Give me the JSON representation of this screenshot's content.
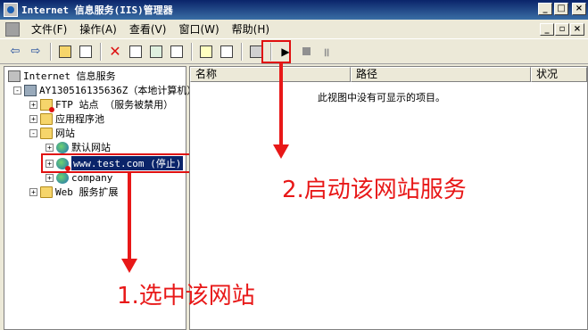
{
  "window": {
    "title": "Internet 信息服务(IIS)管理器"
  },
  "menubar": {
    "items": [
      "文件(F)",
      "操作(A)",
      "查看(V)",
      "窗口(W)",
      "帮助(H)"
    ]
  },
  "toolbar": {
    "buttons": [
      "back-arrow-icon",
      "forward-arrow-icon",
      "up-folder-icon",
      "show-tree-icon",
      "delete-icon",
      "properties-icon",
      "refresh-icon",
      "export-icon",
      "help-icon",
      "console-icon",
      "computer-icon",
      "start-icon",
      "stop-icon",
      "pause-icon"
    ]
  },
  "tree": {
    "root": "Internet 信息服务",
    "computer": "AY130516135636Z（本地计算机）",
    "ftp": "FTP 站点 （服务被禁用）",
    "apppool": "应用程序池",
    "websites": "网站",
    "default_site": "默认网站",
    "test_site": "www.test.com (停止)",
    "company": "company",
    "webext": "Web 服务扩展"
  },
  "list": {
    "columns": [
      "名称",
      "路径",
      "状况"
    ],
    "empty_message": "此视图中没有可显示的项目。"
  },
  "annotations": {
    "step1": "1.选中该网站",
    "step2": "2.启动该网站服务"
  },
  "colors": {
    "annotation_red": "#e81818",
    "titlebar_blue": "#0a246a"
  }
}
